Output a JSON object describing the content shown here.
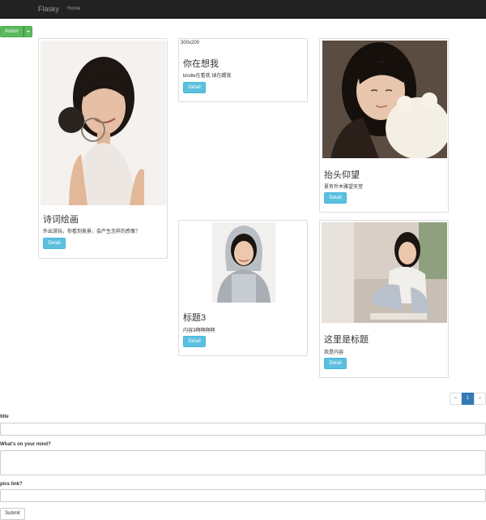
{
  "navbar": {
    "brand": "Flasky",
    "home": "Home"
  },
  "action": {
    "label": "Action"
  },
  "cards": [
    {
      "title": "诗词绘画",
      "text": "外出游玩，你看到美景，会产生怎样的感慨？",
      "button": "Detail",
      "image": "portrait-girl-with-tennis-racket-photo"
    },
    {
      "placeholder": "300x200",
      "title": "你在想我",
      "text": "kindle在看我 球在踢我",
      "button": "Detail"
    },
    {
      "title": "抬头仰望",
      "text": "夏有乔木雅望天堂",
      "button": "Detail",
      "image": "portrait-girl-with-plush-toy-photo"
    },
    {
      "title": "标题3",
      "text": "内容3啊啊啊啊",
      "button": "Detail",
      "image": "portrait-girl-in-hoodie-photo"
    },
    {
      "title": "这里是标题",
      "text": "我是内容",
      "button": "Detail",
      "image": "portrait-girl-sitting-indoors-photo"
    }
  ],
  "pagination": {
    "prev": "«",
    "current": "1",
    "next": "»"
  },
  "form": {
    "title_label": "title",
    "title_value": "",
    "mind_label": "What's on your mind?",
    "mind_value": "",
    "pics_label": "pics link?",
    "pics_value": "",
    "submit_label": "Submit"
  },
  "colors": {
    "navbar": "#222222",
    "action": "#5cb85c",
    "detail": "#5bc0de",
    "page_active": "#337ab7"
  }
}
